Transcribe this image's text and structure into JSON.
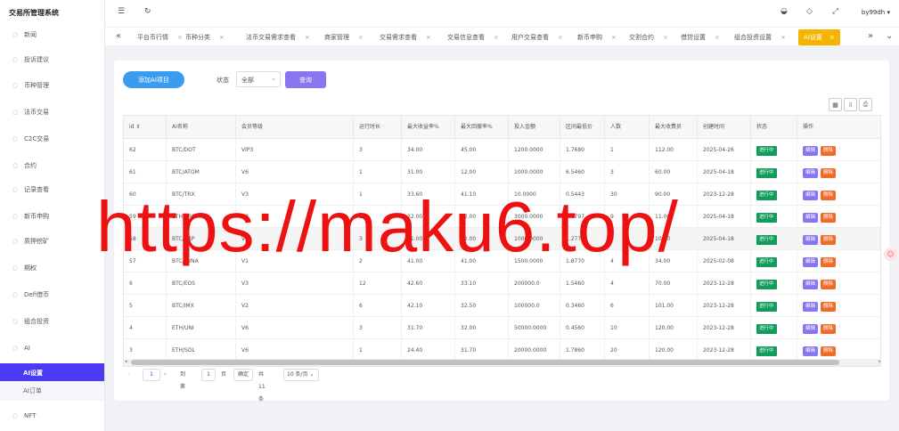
{
  "app": {
    "title": "交易所管理系统",
    "user": "by99dh"
  },
  "sidebar": {
    "items": [
      {
        "label": "新闻",
        "icon": "news-icon"
      },
      {
        "label": "投诉建议",
        "icon": "chat-icon"
      },
      {
        "label": "币种管理",
        "icon": "coin-icon"
      },
      {
        "label": "法币交易",
        "icon": "exchange-icon"
      },
      {
        "label": "C2C交易",
        "icon": "c2c-icon"
      },
      {
        "label": "合约",
        "icon": "contract-icon"
      },
      {
        "label": "记录查看",
        "icon": "record-icon"
      },
      {
        "label": "新币申购",
        "icon": "subscribe-icon"
      },
      {
        "label": "质押挖矿",
        "icon": "mining-icon"
      },
      {
        "label": "期权",
        "icon": "option-icon"
      },
      {
        "label": "Defi借币",
        "icon": "defi-icon"
      },
      {
        "label": "组合投资",
        "icon": "portfolio-icon"
      },
      {
        "label": "AI",
        "icon": "ai-icon"
      },
      {
        "label": "AI设置",
        "icon": ""
      },
      {
        "label": "AI订单",
        "icon": ""
      },
      {
        "label": "NFT",
        "icon": "nft-icon"
      }
    ]
  },
  "tabs": [
    {
      "label": "平台币行情"
    },
    {
      "label": "币种分类"
    },
    {
      "label": "法币交易需求查看"
    },
    {
      "label": "商家管理"
    },
    {
      "label": "交易需求查看"
    },
    {
      "label": "交易信息查看"
    },
    {
      "label": "用户交易查看"
    },
    {
      "label": "新币申购"
    },
    {
      "label": "交割合约"
    },
    {
      "label": "借贷设置"
    },
    {
      "label": "组合投资设置"
    },
    {
      "label": "AI设置"
    }
  ],
  "toolbar": {
    "add_label": "添加AI项目",
    "status_label": "状态",
    "status_value": "全部",
    "query_label": "查询"
  },
  "table": {
    "columns": [
      "id",
      "AI名称",
      "会员等级",
      "运行时长",
      "最大收益率%",
      "最大回撤率%",
      "投入金额",
      "区间最低价",
      "人数",
      "最大收费员",
      "创建时间",
      "状态",
      "操作"
    ],
    "rows": [
      [
        "62",
        "BTC/DOT",
        "VIP3",
        "3",
        "34.00",
        "45.00",
        "1200.0000",
        "1.7680",
        "1",
        "112.00",
        "2025-04-26",
        "进行中"
      ],
      [
        "61",
        "BTC/ATOM",
        "V6",
        "1",
        "31.00",
        "12.00",
        "1000.0000",
        "6.5460",
        "3",
        "60.00",
        "2025-04-18",
        "进行中"
      ],
      [
        "60",
        "BTC/TRX",
        "V3",
        "1",
        "33.60",
        "41.10",
        "10.0000",
        "0.5443",
        "30",
        "90.00",
        "2023-12-28",
        "进行中"
      ],
      [
        "59",
        "ETH/XRP",
        "V0",
        "1",
        "32.00",
        "32.00",
        "3000.0000",
        "4.8797",
        "9",
        "11.00",
        "2025-04-18",
        "进行中"
      ],
      [
        "58",
        "BTC/XRP",
        "V6",
        "3",
        "11.00",
        "32.00",
        "1000.0000",
        "1.2770",
        "5",
        "10.00",
        "2025-04-18",
        "进行中"
      ],
      [
        "57",
        "BTC/LUNA",
        "V1",
        "2",
        "41.00",
        "41.00",
        "1500.0000",
        "1.8770",
        "4",
        "34.00",
        "2025-02-08",
        "进行中"
      ],
      [
        "6",
        "BTC/EOS",
        "V3",
        "12",
        "42.60",
        "33.10",
        "200000.0",
        "1.5460",
        "4",
        "70.00",
        "2023-12-28",
        "进行中"
      ],
      [
        "5",
        "BTC/IMX",
        "V2",
        "6",
        "42.10",
        "32.50",
        "100000.0",
        "0.3460",
        "6",
        "101.00",
        "2023-12-28",
        "进行中"
      ],
      [
        "4",
        "ETH/UNI",
        "V6",
        "3",
        "31.70",
        "32.00",
        "50000.0000",
        "0.4560",
        "10",
        "120.00",
        "2023-12-28",
        "进行中"
      ],
      [
        "3",
        "ETH/SOL",
        "V6",
        "1",
        "24.40",
        "31.70",
        "20000.0000",
        "1.7860",
        "20",
        "120.00",
        "2023-12-28",
        "进行中"
      ]
    ],
    "edit_label": "编辑",
    "delete_label": "删除"
  },
  "pager": {
    "current": "1",
    "goto_label": "到第",
    "goto_value": "1",
    "page_unit": "页",
    "confirm_label": "确定",
    "total": "共 11 条",
    "page_size": "10 条/页"
  },
  "watermark": "https://maku6.top/",
  "colors": {
    "accent": "#4b3bf5",
    "active_tab": "#f4b400",
    "add_btn": "#3a9cf0",
    "query_btn": "#8a75f0",
    "status_green": "#109c5a",
    "delete": "#f06a2a",
    "watermark": "#ee1111"
  }
}
